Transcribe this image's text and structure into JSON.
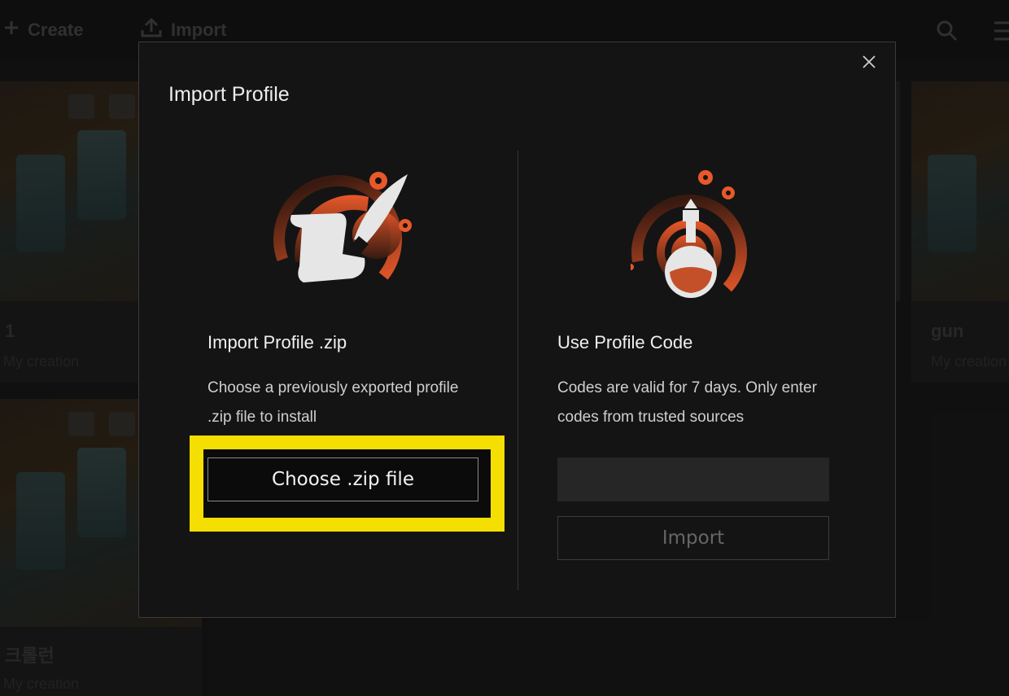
{
  "topbar": {
    "create_label": "Create",
    "import_label": "Import",
    "icons": [
      "plus-icon",
      "upload-icon",
      "search-icon",
      "menu-icon"
    ]
  },
  "background_cards": [
    {
      "name": "1",
      "subtitle": "My creation"
    },
    {
      "name": "gun",
      "subtitle": "My creation"
    },
    {
      "name": "크롤런",
      "subtitle": "My creation"
    }
  ],
  "modal": {
    "title": "Import Profile",
    "close_icon": "close-icon",
    "left": {
      "illustration": "scroll-quill-icon",
      "heading": "Import Profile .zip",
      "description": "Choose a previously exported profile .zip file to install",
      "button_label": "Choose .zip file"
    },
    "right": {
      "illustration": "potion-bottle-icon",
      "heading": "Use Profile Code",
      "description": "Codes are valid for 7 days. Only enter codes from trusted sources",
      "input_value": "",
      "input_placeholder": "",
      "button_label": "Import"
    }
  },
  "colors": {
    "accent": "#e0552a",
    "highlight": "#f4df00",
    "modal_bg": "#141414",
    "input_bg": "#262626"
  }
}
